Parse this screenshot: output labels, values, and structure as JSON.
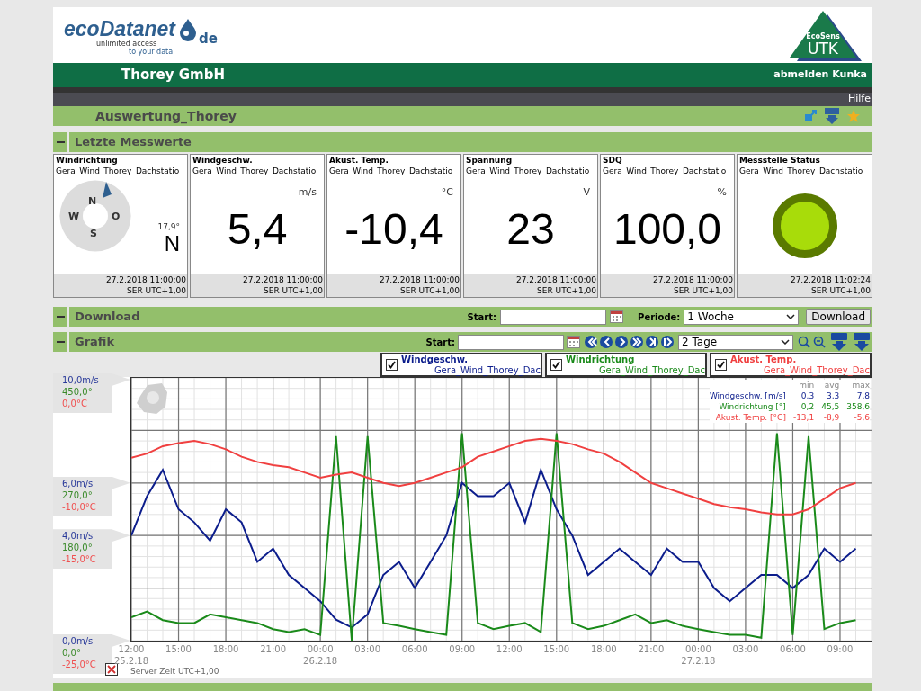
{
  "header": {
    "logo_main": "ecoDatanet",
    "logo_tld": "de",
    "logo_tagline_1": "unlimited access",
    "logo_tagline_2": "to your data",
    "badge_small": "EcoSens",
    "badge_big": "UTK"
  },
  "company_bar": {
    "company": "Thorey GmbH",
    "logout": "abmelden Kunka"
  },
  "help_link": "Hilfe",
  "page_title": "Auswertung_Thorey",
  "latest": {
    "title": "Letzte Messwerte",
    "expanded": true,
    "tiles": [
      {
        "kind": "compass",
        "title": "Windrichtung",
        "station": "Gera_Wind_Thorey_Dachstatio",
        "letters": [
          "N",
          "O",
          "S",
          "W"
        ],
        "degrees": "17,9°",
        "direction": "N",
        "date": "27.2.2018 11:00:00",
        "zone": "SER UTC+1,00"
      },
      {
        "kind": "value",
        "title": "Windgeschw.",
        "station": "Gera_Wind_Thorey_Dachstatio",
        "unit": "m/s",
        "value": "5,4",
        "date": "27.2.2018 11:00:00",
        "zone": "SER UTC+1,00"
      },
      {
        "kind": "value",
        "title": "Akust. Temp.",
        "station": "Gera_Wind_Thorey_Dachstatio",
        "unit": "°C",
        "value": "-10,4",
        "date": "27.2.2018 11:00:00",
        "zone": "SER UTC+1,00"
      },
      {
        "kind": "value",
        "title": "Spannung",
        "station": "Gera_Wind_Thorey_Dachstatio",
        "unit": "V",
        "value": "23",
        "date": "27.2.2018 11:00:00",
        "zone": "SER UTC+1,00"
      },
      {
        "kind": "value",
        "title": "SDQ",
        "station": "Gera_Wind_Thorey_Dachstatio",
        "unit": "%",
        "value": "100,0",
        "date": "27.2.2018 11:00:00",
        "zone": "SER UTC+1,00"
      },
      {
        "kind": "status",
        "title": "Messstelle Status",
        "station": "Gera_Wind_Thorey_Dachstatio",
        "color": "#a8dc0a",
        "date": "27.2.2018 11:02:24",
        "zone": "SER UTC+1,00"
      }
    ]
  },
  "download": {
    "title": "Download",
    "expanded": true,
    "start_label": "Start:",
    "period_label": "Periode:",
    "period": "1 Woche",
    "button": "Download"
  },
  "grafik": {
    "title": "Grafik",
    "expanded": true,
    "start_label": "Start:",
    "range": "2 Tage",
    "legend": [
      {
        "station": "Gera_Wind_Thorey_Dac",
        "checked": true
      },
      {
        "station": "Gera_Wind_Thorey_Dac",
        "checked": true
      },
      {
        "station": "Gera_Wind_Thorey_Dac",
        "checked": true
      }
    ],
    "axis_labels": [
      {
        "dir": "450,0°",
        "temp": "0,0°C"
      },
      {
        "dir": "270,0°",
        "temp": "-10,0°C"
      },
      {
        "dir": "180,0°",
        "temp": "-15,0°C"
      },
      {
        "dir": "0,0°",
        "temp": "-25,0°C"
      }
    ],
    "stats_header": [
      "min",
      "avg",
      "max"
    ],
    "stats": [
      {
        "label": "Windgeschw. [m/s]",
        "min": "0,3",
        "avg": "3,3",
        "max": "7,8"
      },
      {
        "label": "Windrichtung [°]",
        "min": "0,2",
        "avg": "45,5",
        "max": "358,6"
      },
      {
        "label": "Akust. Temp. [°C]",
        "min": "-13,1",
        "avg": "-8,9",
        "max": "-5,6"
      }
    ],
    "server_time": "Server Zeit UTC+1,00",
    "date_labels": [
      "25.2.18",
      "26.2.18",
      "27.2.18"
    ],
    "chart_data": {
      "type": "line",
      "x": [
        "2018-02-25T12:00",
        "2018-02-25T13:00",
        "2018-02-25T14:00",
        "2018-02-25T15:00",
        "2018-02-25T16:00",
        "2018-02-25T17:00",
        "2018-02-25T18:00",
        "2018-02-25T19:00",
        "2018-02-25T20:00",
        "2018-02-25T21:00",
        "2018-02-25T22:00",
        "2018-02-25T23:00",
        "2018-02-26T00:00",
        "2018-02-26T01:00",
        "2018-02-26T02:00",
        "2018-02-26T03:00",
        "2018-02-26T04:00",
        "2018-02-26T05:00",
        "2018-02-26T06:00",
        "2018-02-26T07:00",
        "2018-02-26T08:00",
        "2018-02-26T09:00",
        "2018-02-26T10:00",
        "2018-02-26T11:00",
        "2018-02-26T12:00",
        "2018-02-26T13:00",
        "2018-02-26T14:00",
        "2018-02-26T15:00",
        "2018-02-26T16:00",
        "2018-02-26T17:00",
        "2018-02-26T18:00",
        "2018-02-26T19:00",
        "2018-02-26T20:00",
        "2018-02-26T21:00",
        "2018-02-26T22:00",
        "2018-02-26T23:00",
        "2018-02-27T00:00",
        "2018-02-27T01:00",
        "2018-02-27T02:00",
        "2018-02-27T03:00",
        "2018-02-27T04:00",
        "2018-02-27T05:00",
        "2018-02-27T06:00",
        "2018-02-27T07:00",
        "2018-02-27T08:00",
        "2018-02-27T09:00",
        "2018-02-27T10:00"
      ],
      "xlim": [
        "2018-02-25T12:00",
        "2018-02-27T11:00"
      ],
      "ylim": [
        0,
        10
      ],
      "grid": true,
      "xticks": [
        {
          "value": "2018-02-25T12:00",
          "label": "12:00"
        },
        {
          "value": "2018-02-25T15:00",
          "label": "15:00"
        },
        {
          "value": "2018-02-25T18:00",
          "label": "18:00"
        },
        {
          "value": "2018-02-25T21:00",
          "label": "21:00"
        },
        {
          "value": "2018-02-26T00:00",
          "label": "00:00"
        },
        {
          "value": "2018-02-26T03:00",
          "label": "03:00"
        },
        {
          "value": "2018-02-26T06:00",
          "label": "06:00"
        },
        {
          "value": "2018-02-26T09:00",
          "label": "09:00"
        },
        {
          "value": "2018-02-26T12:00",
          "label": "12:00"
        },
        {
          "value": "2018-02-26T15:00",
          "label": "15:00"
        },
        {
          "value": "2018-02-26T18:00",
          "label": "18:00"
        },
        {
          "value": "2018-02-26T21:00",
          "label": "21:00"
        },
        {
          "value": "2018-02-27T00:00",
          "label": "00:00"
        },
        {
          "value": "2018-02-27T03:00",
          "label": "03:00"
        },
        {
          "value": "2018-02-27T06:00",
          "label": "06:00"
        },
        {
          "value": "2018-02-27T09:00",
          "label": "09:00"
        }
      ],
      "yticks": [
        {
          "value": 10,
          "label": "10,0m/s"
        },
        {
          "value": 6,
          "label": "6,0m/s"
        },
        {
          "value": 4,
          "label": "4,0m/s"
        },
        {
          "value": 0,
          "label": "0,0m/s"
        }
      ],
      "series": [
        {
          "name": "Windgeschw.",
          "color": "#0c1d8c",
          "values": [
            4.0,
            5.5,
            6.5,
            5.0,
            4.5,
            3.8,
            5.0,
            4.5,
            3.0,
            3.5,
            2.5,
            2.0,
            1.5,
            0.8,
            0.5,
            1.0,
            2.5,
            3.0,
            2.0,
            3.0,
            4.0,
            6.0,
            5.5,
            5.5,
            6.0,
            4.5,
            6.5,
            5.0,
            4.0,
            2.5,
            3.0,
            3.5,
            3.0,
            2.5,
            3.5,
            3.0,
            3.0,
            2.0,
            1.5,
            2.0,
            2.5,
            2.5,
            2.0,
            2.5,
            3.5,
            3.0,
            3.5
          ]
        },
        {
          "name": "Windrichtung",
          "color": "#1a8a1a",
          "values": [
            0.89,
            1.11,
            0.78,
            0.67,
            0.67,
            1.0,
            0.89,
            0.78,
            0.67,
            0.44,
            0.33,
            0.44,
            0.22,
            7.78,
            0.0,
            7.78,
            0.67,
            0.56,
            0.44,
            0.33,
            0.22,
            7.89,
            0.67,
            0.44,
            0.56,
            0.67,
            0.33,
            7.89,
            0.67,
            0.44,
            0.56,
            0.78,
            1.0,
            0.67,
            0.78,
            0.56,
            0.44,
            0.33,
            0.22,
            0.22,
            0.11,
            7.89,
            0.22,
            7.78,
            0.44,
            0.67,
            0.78
          ]
        },
        {
          "name": "Akust. Temp.",
          "color": "#f04040",
          "values": [
            6.96,
            7.12,
            7.4,
            7.52,
            7.6,
            7.48,
            7.28,
            7.0,
            6.8,
            6.68,
            6.6,
            6.4,
            6.2,
            6.32,
            6.4,
            6.2,
            6.0,
            5.88,
            6.0,
            6.2,
            6.4,
            6.6,
            7.0,
            7.2,
            7.4,
            7.6,
            7.68,
            7.6,
            7.48,
            7.28,
            7.12,
            6.8,
            6.4,
            6.0,
            5.8,
            5.6,
            5.4,
            5.2,
            5.08,
            5.0,
            4.88,
            4.8,
            4.8,
            5.0,
            5.4,
            5.8,
            6.0
          ]
        }
      ]
    }
  }
}
